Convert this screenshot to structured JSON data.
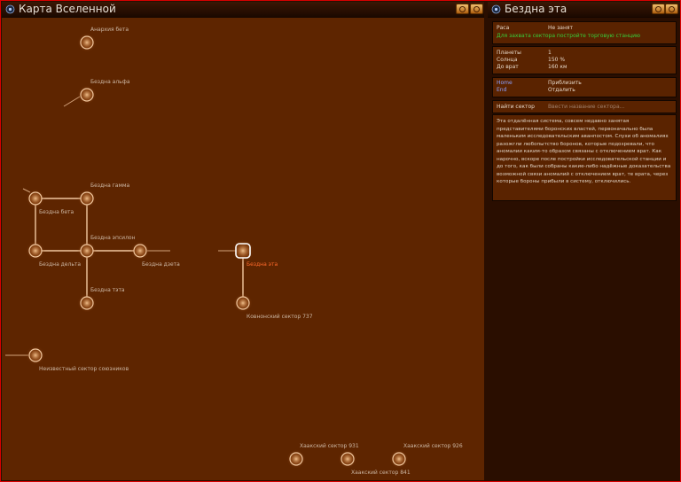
{
  "map": {
    "title": "Карта Вселенной",
    "selected": "Бездна эта",
    "sectors": [
      {
        "id": "anarchy-beta",
        "name": "Анархия бета"
      },
      {
        "id": "abyss-alpha",
        "name": "Бездна альфа"
      },
      {
        "id": "abyss-gamma",
        "name": "Бездна гамма"
      },
      {
        "id": "abyss-beta",
        "name": "Бездна бета"
      },
      {
        "id": "abyss-epsilon",
        "name": "Бездна эпсилон"
      },
      {
        "id": "abyss-delta",
        "name": "Бездна дельта"
      },
      {
        "id": "abyss-zeta",
        "name": "Бездна дзета"
      },
      {
        "id": "abyss-eta",
        "name": "Бездна эта"
      },
      {
        "id": "abyss-theta",
        "name": "Бездна тэта"
      },
      {
        "id": "kovnon-737",
        "name": "Ковнонский сектор 737"
      },
      {
        "id": "unknown-allies",
        "name": "Неизвестный сектор союзников"
      },
      {
        "id": "khaak-931",
        "name": "Хаакский сектор 931"
      },
      {
        "id": "khaak-926",
        "name": "Хаакский сектор 926"
      },
      {
        "id": "khaak-841",
        "name": "Хаакский сектор 841"
      }
    ]
  },
  "sector_panel": {
    "title": "Бездна эта",
    "race_label": "Раса",
    "race_value": "Не занят",
    "capture_hint": "Для захвата сектора постройте торговую станцию",
    "planets_label": "Планеты",
    "planets_value": "1",
    "suns_label": "Солнца",
    "suns_value": "150 %",
    "gate_label": "До врат",
    "gate_value": "160 км",
    "home_key": "Home",
    "home_action": "Приблизить",
    "end_key": "End",
    "end_action": "Отдалить",
    "find_label": "Найти сектор",
    "find_placeholder": "Ввести название сектора...",
    "description": "Эта отдалённая система, совсем недавно занятая представителями боронских властей, первоначально была маленьким исследовательским аванпостом. Слухи об аномалиях разожгли любопытство боронов, которые подозревали, что аномалии каким-то образом связаны с отключением врат. Как нарочно, вскоре после постройки исследовательской станции и до того, как были собраны какие-либо надёжные доказательства возможной связи аномалий с отключением врат, те врата, через которые бороны прибыли в систему, отключились."
  },
  "colors": {
    "accent": "#ff6a2a",
    "hint_green": "#38d03a",
    "key_blue": "#8aa0ff",
    "frame_red": "#d80000"
  },
  "icons": {
    "title_icon": "star-map-icon",
    "pin_button": "pin-icon",
    "minimize_button": "minimize-icon",
    "back_button": "back-icon",
    "close_button": "close-icon"
  }
}
